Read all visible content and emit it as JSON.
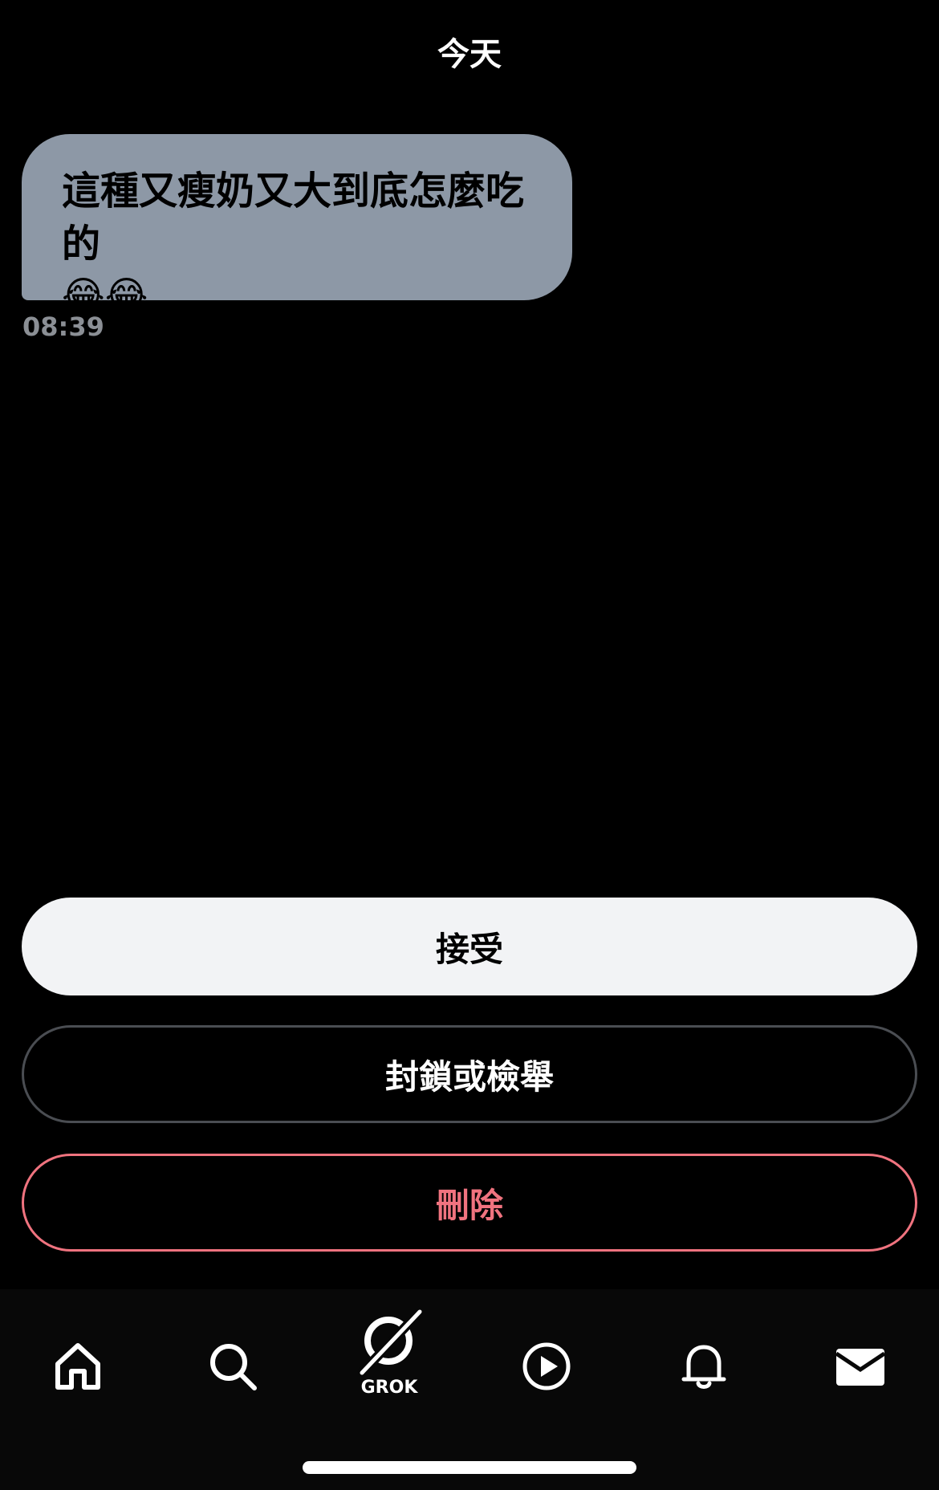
{
  "header": {
    "date_label": "今天"
  },
  "message": {
    "text": "這種又瘦奶又大到底怎麼吃的",
    "emoji": "😂😂",
    "time": "08:39"
  },
  "actions": {
    "accept": "接受",
    "block_report": "封鎖或檢舉",
    "delete": "刪除"
  },
  "tab_bar": {
    "items": [
      {
        "icon": "home-icon"
      },
      {
        "icon": "search-icon"
      },
      {
        "icon": "grok-icon",
        "label": "GROK"
      },
      {
        "icon": "play-icon"
      },
      {
        "icon": "bell-icon"
      },
      {
        "icon": "mail-icon"
      }
    ]
  },
  "colors": {
    "background": "#000000",
    "bubble": "#8d98a6",
    "accept_button": "#f2f3f5",
    "delete": "#f0737f",
    "muted_text": "#8b8f95"
  }
}
